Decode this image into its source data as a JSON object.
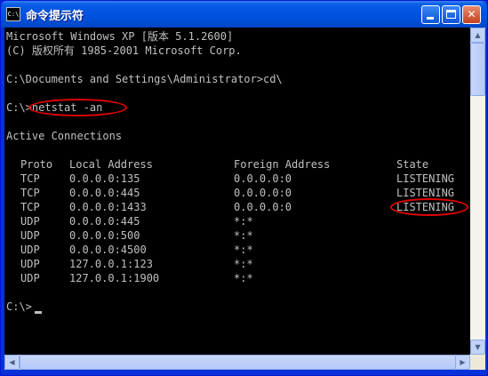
{
  "window": {
    "title": "命令提示符",
    "icon_label": "C:\\",
    "buttons": {
      "minimize": "minimize",
      "maximize": "maximize",
      "close": "✕"
    }
  },
  "console": {
    "header_line1": "Microsoft Windows XP [版本 5.1.2600]",
    "header_line2": "(C) 版权所有 1985-2001 Microsoft Corp.",
    "prompt_cd": "C:\\Documents and Settings\\Administrator>cd\\",
    "prompt_netstat": "C:\\>netstat -an",
    "active_connections": "Active Connections",
    "table": {
      "headers": [
        "Proto",
        "Local Address",
        "Foreign Address",
        "State"
      ],
      "rows": [
        [
          "TCP",
          "0.0.0.0:135",
          "0.0.0.0:0",
          "LISTENING"
        ],
        [
          "TCP",
          "0.0.0.0:445",
          "0.0.0.0:0",
          "LISTENING"
        ],
        [
          "TCP",
          "0.0.0.0:1433",
          "0.0.0.0:0",
          "LISTENING"
        ],
        [
          "UDP",
          "0.0.0.0:445",
          "*:*",
          ""
        ],
        [
          "UDP",
          "0.0.0.0:500",
          "*:*",
          ""
        ],
        [
          "UDP",
          "0.0.0.0:4500",
          "*:*",
          ""
        ],
        [
          "UDP",
          "127.0.0.1:123",
          "*:*",
          ""
        ],
        [
          "UDP",
          "127.0.0.1:1900",
          "*:*",
          ""
        ]
      ]
    },
    "final_prompt": "C:\\>"
  },
  "colors": {
    "console_bg": "#000000",
    "console_text": "#c0c0c0",
    "annotation": "#e10000",
    "titlebar": "#0054e3"
  },
  "scrollbars": {
    "up_arrow": "▲",
    "down_arrow": "▼",
    "left_arrow": "◀",
    "right_arrow": "▶"
  }
}
